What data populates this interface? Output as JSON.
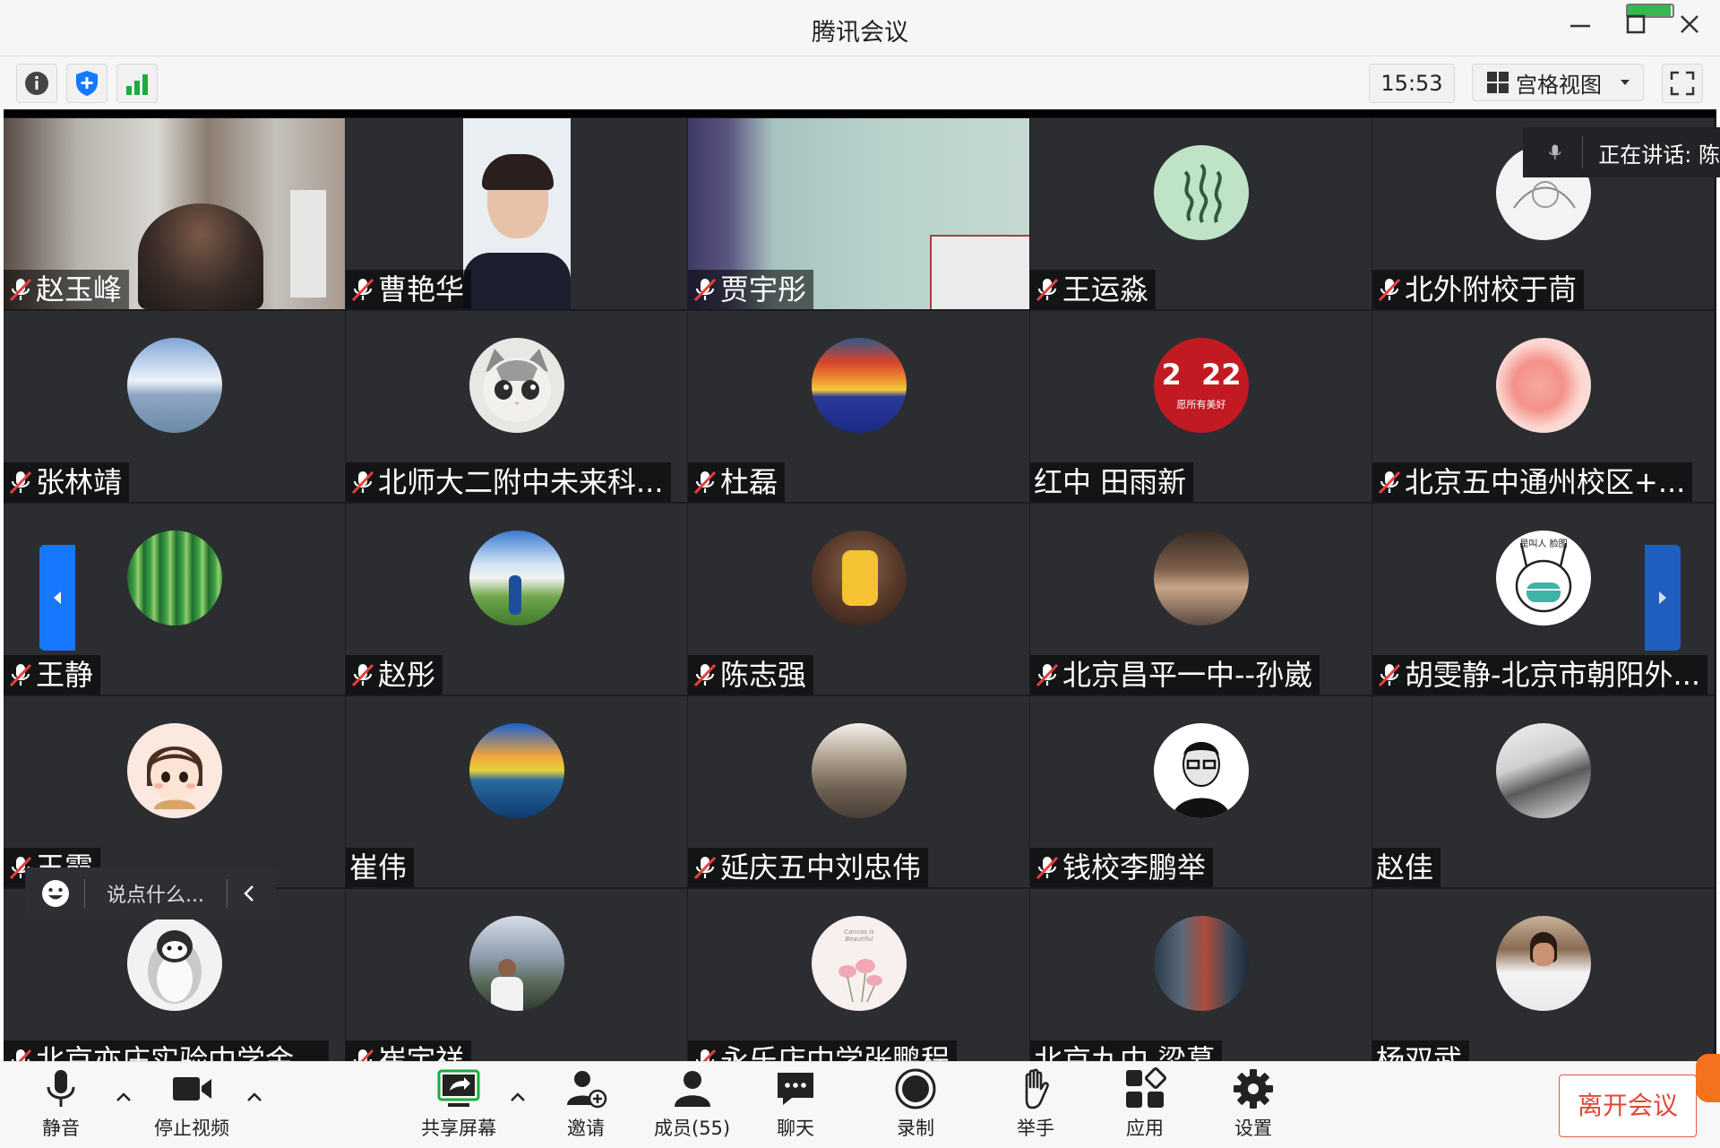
{
  "window": {
    "title": "腾讯会议",
    "battery_level": 0.95
  },
  "infobar": {
    "time": "15:53",
    "view_mode": "宫格视图"
  },
  "speaking": {
    "label": "正在讲话: 陈"
  },
  "chat": {
    "placeholder": "说点什么..."
  },
  "participants": [
    {
      "name": "赵玉峰",
      "muted": true
    },
    {
      "name": "曹艳华",
      "muted": true
    },
    {
      "name": "贾宇彤",
      "muted": true
    },
    {
      "name": "王运淼",
      "muted": true
    },
    {
      "name": "北外附校于茼",
      "muted": true
    },
    {
      "name": "张林靖",
      "muted": true
    },
    {
      "name": "北师大二附中未来科...",
      "muted": true
    },
    {
      "name": "杜磊",
      "muted": true
    },
    {
      "name": "红中 田雨新",
      "muted": false
    },
    {
      "name": "北京五中通州校区+...",
      "muted": true
    },
    {
      "name": "王静",
      "muted": true
    },
    {
      "name": "赵彤",
      "muted": true
    },
    {
      "name": "陈志强",
      "muted": true
    },
    {
      "name": "北京昌平一中--孙崴",
      "muted": true
    },
    {
      "name": "胡雯静-北京市朝阳外...",
      "muted": true
    },
    {
      "name": "王霞",
      "muted": true
    },
    {
      "name": "崔伟",
      "muted": false
    },
    {
      "name": "延庆五中刘忠伟",
      "muted": true
    },
    {
      "name": "钱校李鹏举",
      "muted": true
    },
    {
      "name": "赵佳",
      "muted": false
    },
    {
      "name": "北京亦庄实验中学金...",
      "muted": true
    },
    {
      "name": "崔宇祥",
      "muted": true
    },
    {
      "name": "永乐店中学张鹏程",
      "muted": true
    },
    {
      "name": "北京九中 梁慕",
      "muted": false
    },
    {
      "name": "杨双武",
      "muted": false
    }
  ],
  "avatar_text": {
    "year_badge": "2  22",
    "year_badge_sub": "愿所有美好",
    "flower_caption": "Canvas is Beautiful",
    "mask_caption": "是叫人 脸图"
  },
  "toolbar": {
    "mute": "静音",
    "stop_video": "停止视频",
    "share_screen": "共享屏幕",
    "invite": "邀请",
    "members": "成员(55)",
    "chat": "聊天",
    "record": "录制",
    "raise_hand": "举手",
    "apps": "应用",
    "settings": "设置",
    "leave": "离开会议"
  },
  "colors": {
    "accent_blue": "#1677ff",
    "leave_red": "#e0483a",
    "share_green": "#1aad3b",
    "tile_bg": "#2c2d31"
  }
}
